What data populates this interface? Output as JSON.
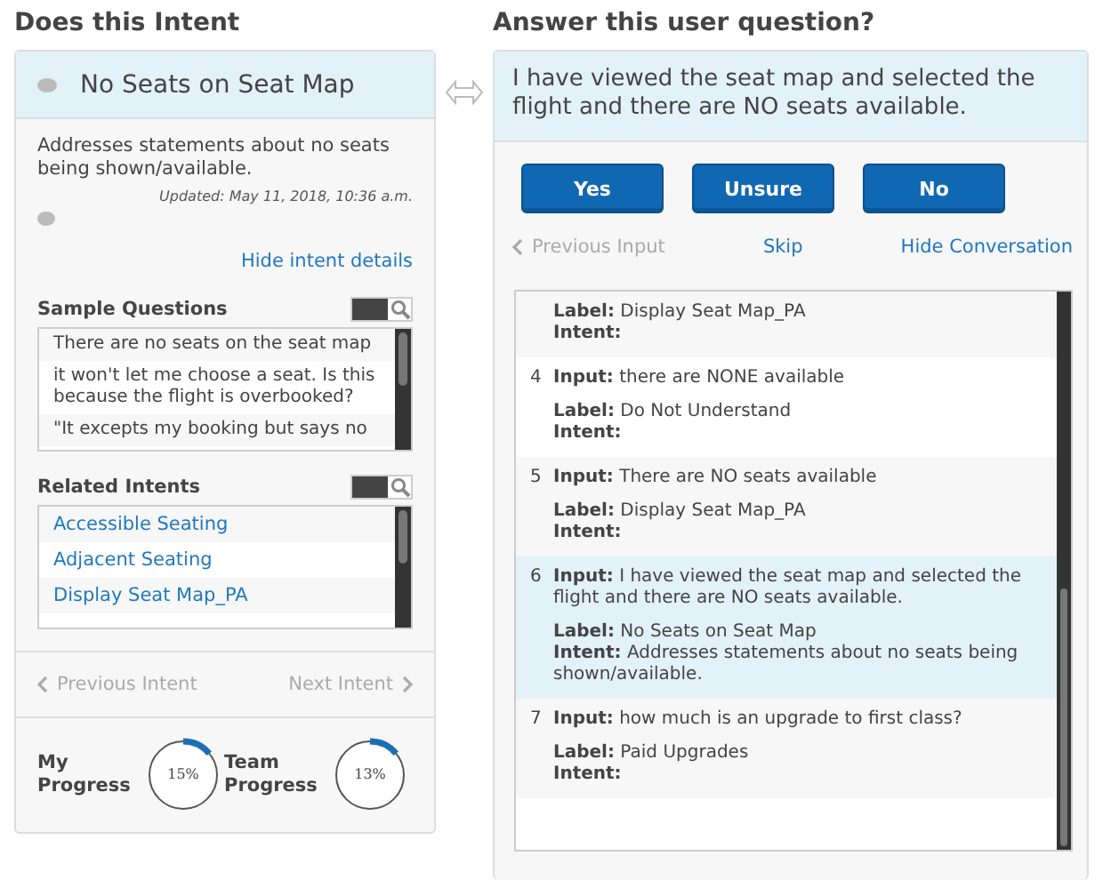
{
  "left": {
    "heading": "Does this Intent",
    "intent": {
      "title": "No Seats on Seat Map",
      "description": "Addresses statements about no seats being shown/available.",
      "updated": "Updated: May 11, 2018, 10:36 a.m.",
      "details_link": "Hide intent details"
    },
    "sample_questions": {
      "title": "Sample Questions",
      "search_on": true,
      "items": [
        {
          "text": "There are no seats on the seat map"
        },
        {
          "text": "it won't let me choose a seat. Is this because the flight is overbooked?"
        },
        {
          "text": "\"It excepts my booking but says no"
        }
      ]
    },
    "related_intents": {
      "title": "Related Intents",
      "search_on": true,
      "items": [
        {
          "text": "Accessible Seating"
        },
        {
          "text": "Adjacent Seating"
        },
        {
          "text": "Display Seat Map_PA"
        }
      ]
    },
    "nav": {
      "previous": "Previous Intent",
      "next": "Next Intent"
    },
    "progress": [
      {
        "label": "My Progress",
        "reading": "15%"
      },
      {
        "label": "Team Progress",
        "reading": "13%"
      }
    ]
  },
  "right": {
    "heading": "Answer this user question?",
    "question": "I have viewed the seat map and selected the flight and there are NO seats available.",
    "buttons": [
      "Yes",
      "Unsure",
      "No"
    ],
    "links": {
      "previous": "Previous Input",
      "skip": "Skip",
      "hide": "Hide Conversation"
    },
    "conversation": [
      {
        "label": "**Label:** Display Seat Map_PA",
        "intent": "**Intent:**",
        "selected": false
      },
      {
        "number": "4",
        "input": "**Input:** there are NONE available",
        "label": "**Label:** Do Not Understand",
        "intent": "**Intent:**",
        "selected": false
      },
      {
        "number": "5",
        "input": "**Input:** There are NO seats available",
        "label": "**Label:** Display Seat Map_PA",
        "intent": "**Intent:**",
        "selected": false
      },
      {
        "number": "6",
        "input": "**Input:** I have viewed the seat map and selected the flight and there are NO seats available.",
        "label": "**Label:** No Seats on Seat Map",
        "intent": "**Intent:** Addresses statements about no seats being shown/available.",
        "selected": true
      },
      {
        "number": "7",
        "input": "**Input:** how much is an upgrade to first class?",
        "label": "**Label:** Paid Upgrades",
        "intent": "**Intent:**",
        "selected": false
      }
    ]
  }
}
